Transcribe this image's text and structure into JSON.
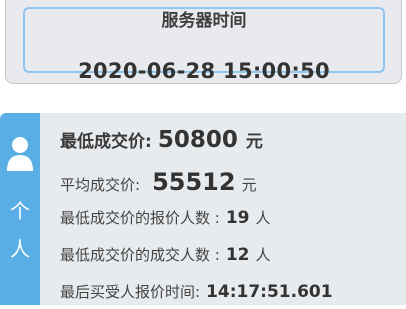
{
  "server_time": {
    "title": "服务器时间",
    "value": "2020-06-28 15:00:50"
  },
  "person_tab": {
    "label_line1": "个",
    "label_line2": "人"
  },
  "stats": {
    "lowest_price": {
      "label": "最低成交价:",
      "value": "50800",
      "unit": "元"
    },
    "average_price": {
      "label": "平均成交价:",
      "value": "55512",
      "unit": "元"
    },
    "lowest_price_bidders": {
      "label": "最低成交价的报价人数 :",
      "value": "19",
      "unit": "人"
    },
    "lowest_price_deals": {
      "label": "最低成交价的成交人数 :",
      "value": "12",
      "unit": "人"
    },
    "last_accepted_bid_time": {
      "label": "最后买受人报价时间:",
      "value": "14:17:51.601"
    }
  },
  "colors": {
    "tab_blue": "#5aaee6",
    "panel_gray": "#e8ebee",
    "border_blue": "#8fc7ee"
  }
}
